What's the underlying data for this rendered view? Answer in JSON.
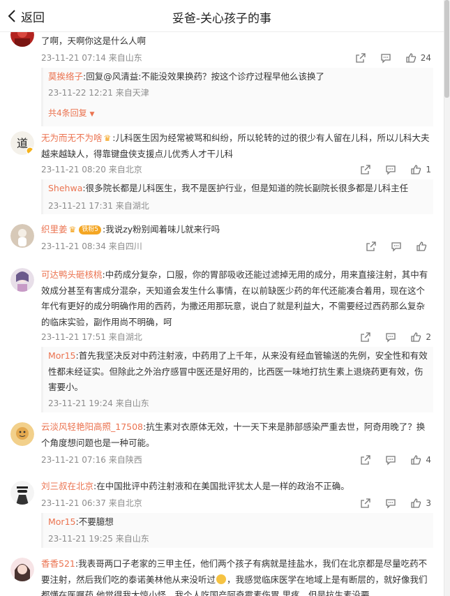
{
  "header": {
    "back_label": "返回",
    "title": "妥爸-关心孩子的事"
  },
  "comments": [
    {
      "text": "了啊，天啊你这是什么人啊",
      "time": "23-11-21 07:14",
      "location": "来自山东",
      "likes": "24",
      "replies": [
        {
          "name": "莫挨络子",
          "text": ":回复@风清益:不能没效果换药？按这个诊疗过程早他么该换了",
          "time": "23-11-22 12:21",
          "location": "来自天津"
        }
      ],
      "more_label": "共4条回复"
    },
    {
      "name": "无为而无不为啥",
      "text": ":儿科医生因为经常被骂和纠纷，所以轮转的过的很少有人留在儿科，所以儿科大夫越来越缺人，得靠键盘侠支援点儿优秀人才干儿科",
      "time": "23-11-21 08:20",
      "location": "来自北京",
      "likes": "1",
      "replies": [
        {
          "name": "Shehwa",
          "text": ":很多院长都是儿科医生，我不是医护行业，但是知道的院长副院长很多都是儿科主任",
          "time": "23-11-21 17:31",
          "location": "来自湖北"
        }
      ]
    },
    {
      "name": "织里姜",
      "badge": "铁粉5",
      "text": ":我说zy粉别闻着味儿就来行吗",
      "time": "23-11-21 08:34",
      "location": "来自四川",
      "likes": ""
    },
    {
      "name": "可达鸭头砸核桃",
      "text": ":中药成分复杂，口服，你的胃部吸收还能过滤掉无用的成分，用来直接注射，其中有效成分甚至有害成分混杂，天知道会发生什么事情，在以前缺医少药的年代还能凑合着用，现在这个年代有更好的成分明确作用的西药，为撒还用那玩意，说白了就是利益大，不需要经过西药那么复杂的临床实验，副作用尚不明确，呵",
      "time": "23-11-21 17:51",
      "location": "来自湖北",
      "likes": "2",
      "replies": [
        {
          "name": "Mor15",
          "text": ":首先我坚决反对中药注射液，中药用了上千年，从来没有经血管输送的先例，安全性和有效性都未经证实。但除此之外治疗感冒中医还是好用的，比西医一味地打抗生素上退烧药更有效，伤害要小。",
          "time": "23-11-21 19:24",
          "location": "来自山东"
        }
      ]
    },
    {
      "name": "云淡风轻艳阳高照_17508",
      "text": ":抗生素对衣原体无效，十一天下来是肺部感染严重去世，阿奇用晚了？换个角度想问题也是一种可能。",
      "time": "23-11-21 07:16",
      "location": "来自陕西",
      "likes": "4"
    },
    {
      "name": "刘三叔在北京",
      "text": ":在中国批评中药注射液和在美国批评犹太人是一样的政治不正确。",
      "time": "23-11-21 06:37",
      "location": "来自北京",
      "likes": "3",
      "replies": [
        {
          "name": "Mor15",
          "text": ":不要臆想",
          "time": "23-11-21 19:25",
          "location": "来自山东"
        }
      ]
    },
    {
      "name": "香香521",
      "text": ":我表哥两口子老家的三甲主任，他们两个孩子有病就是挂盐水，我们在北京都是尽量吃药不要注射，然后我们吃的泰诺美林他从来没听过",
      "text_after_emoji": "，我感觉临床医学在地域上是有断层的，就好像我们都懂在医嘱药 他觉得我大惊小怪，我个人吃国产阿奇霉素伤胃 里疼，但是抗生素没要"
    }
  ]
}
